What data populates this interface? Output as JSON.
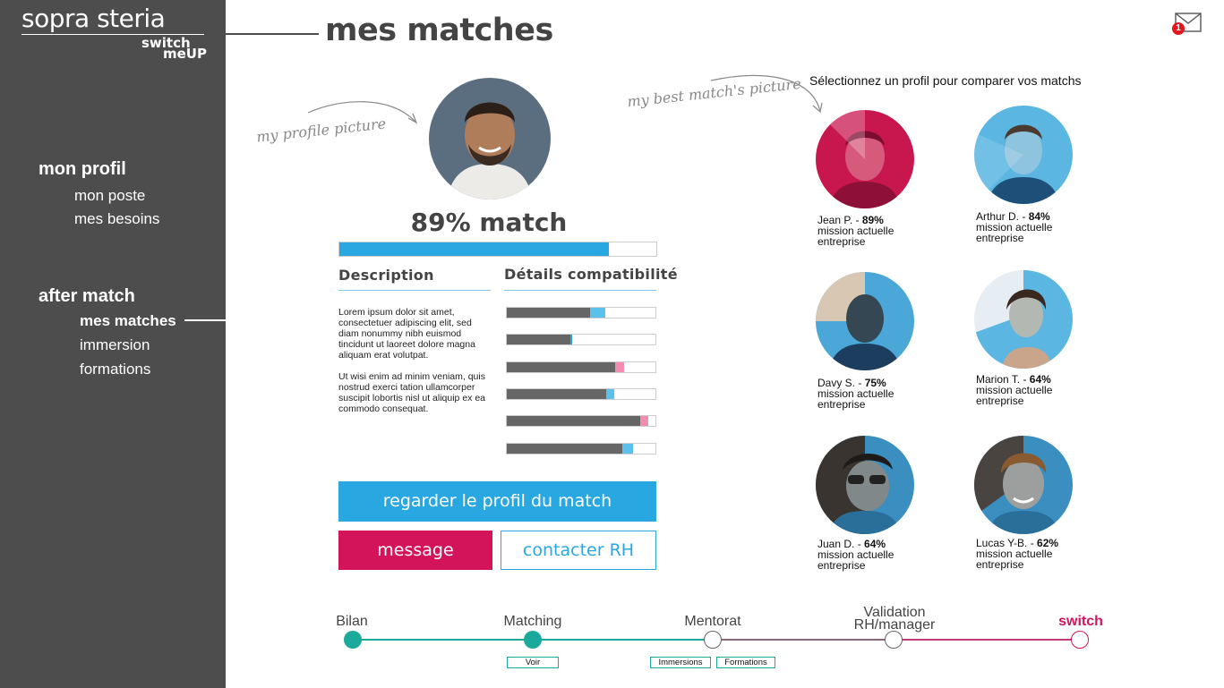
{
  "brand": {
    "name": "sopra steria",
    "sub_line1": "switch",
    "sub_line2": "meUP"
  },
  "nav": {
    "section1_title": "mon profil",
    "section1_items": [
      "mon poste",
      "mes besoins"
    ],
    "section2_title": "after match",
    "section2_items": [
      "mes matches",
      "immersion",
      "formations"
    ],
    "active_item": "mes matches"
  },
  "header": {
    "title": "mes matches",
    "notification_count": "1"
  },
  "annotations": {
    "profile_picture": "my profile picture",
    "best_match_picture": "my best match's picture"
  },
  "profile": {
    "match_label": "89% match",
    "match_progress": 0.85,
    "description_heading": "Description",
    "compat_heading": "Détails compatibilité",
    "description_p1": "Lorem ipsum dolor sit amet, consectetuer adipiscing elit, sed diam nonummy nibh euismod tincidunt ut laoreet dolore magna aliquam erat volutpat.",
    "description_p2": "Ut wisi enim ad minim veniam, quis nostrud exerci tation ullamcorper suscipit lobortis nisl ut aliquip ex ea commodo consequat.",
    "compat_bars": [
      {
        "base": 0.56,
        "extra": 0.1,
        "color": "#5bc0ea"
      },
      {
        "base": 0.43,
        "extra": 0.01,
        "color": "#29a7e1"
      },
      {
        "base": 0.73,
        "extra": 0.06,
        "color": "#f28cb1"
      },
      {
        "base": 0.67,
        "extra": 0.05,
        "color": "#5bc0ea"
      },
      {
        "base": 0.9,
        "extra": 0.05,
        "color": "#f28cb1"
      },
      {
        "base": 0.78,
        "extra": 0.07,
        "color": "#5bc0ea"
      }
    ]
  },
  "actions": {
    "view_profile": "regarder le profil du match",
    "message": "message",
    "contact_hr": "contacter RH"
  },
  "matches": {
    "hint": "Sélectionnez un profil pour comparer vos matchs",
    "cards": [
      {
        "name": "Jean P. - ",
        "pct": "89%",
        "line2": "mission actuelle",
        "line3": "entreprise",
        "tint": "#c8174f"
      },
      {
        "name": "Arthur D. - ",
        "pct": "84%",
        "line2": "mission actuelle",
        "line3": "entreprise",
        "tint": "#5bb6e2"
      },
      {
        "name": "Davy S. - ",
        "pct": "75%",
        "line2": "mission actuelle",
        "line3": "entreprise",
        "tint": "#4aa7d8"
      },
      {
        "name": "Marion T. - ",
        "pct": "64%",
        "line2": "mission actuelle",
        "line3": "entreprise",
        "tint": "#5bb6e2"
      },
      {
        "name": "Juan D. - ",
        "pct": "64%",
        "line2": "mission actuelle",
        "line3": "entreprise",
        "tint": "#3a8fc0"
      },
      {
        "name": "Lucas Y-B. - ",
        "pct": "62%",
        "line2": "mission actuelle",
        "line3": "entreprise",
        "tint": "#3a8fc0"
      }
    ]
  },
  "timeline": {
    "steps": [
      "Bilan",
      "Matching",
      "Mentorat",
      "Validation RH/manager",
      "switch"
    ],
    "tags": {
      "voir": "Voir",
      "immersions": "Immersions",
      "formations": "Formations"
    },
    "colors": {
      "done": "#1aa99b",
      "pending": "#ffffff",
      "switch": "#d3145a"
    }
  }
}
